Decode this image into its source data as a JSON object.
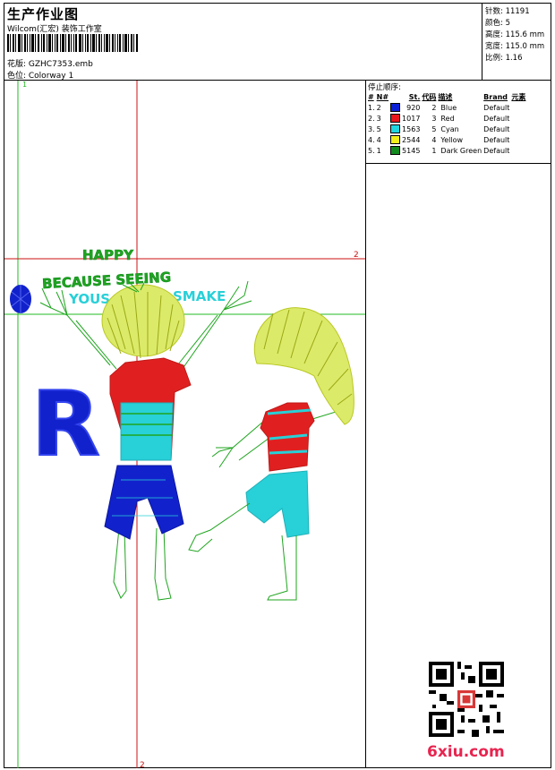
{
  "header": {
    "title": "生产作业图",
    "subtitle": "Wilcom(汇宏) 装饰工作室",
    "design_label": "花版: GZHC7353.emb",
    "colorway_label": "色位: Colorway 1"
  },
  "stats": [
    "针数: 11191",
    "颜色: 5",
    "高度: 115.6 mm",
    "宽度: 115.0 mm",
    "比例: 1.16"
  ],
  "stop_sequence": {
    "title": "停止顺序:",
    "headers": [
      "#",
      "N#",
      "St.",
      "代码",
      "描述",
      "Brand",
      "元素"
    ],
    "rows": [
      {
        "idx": "1.",
        "n": "2",
        "color": "#0a1fd6",
        "st": "920",
        "code": "2",
        "desc": "Blue",
        "brand": "Default"
      },
      {
        "idx": "2.",
        "n": "3",
        "color": "#e8161b",
        "st": "1017",
        "code": "3",
        "desc": "Red",
        "brand": "Default"
      },
      {
        "idx": "3.",
        "n": "5",
        "color": "#22d6e0",
        "st": "1563",
        "code": "5",
        "desc": "Cyan",
        "brand": "Default"
      },
      {
        "idx": "4.",
        "n": "4",
        "color": "#f2ef1a",
        "st": "2544",
        "code": "4",
        "desc": "Yellow",
        "brand": "Default"
      },
      {
        "idx": "5.",
        "n": "1",
        "color": "#128a1e",
        "st": "5145",
        "code": "1",
        "desc": "Dark Green",
        "brand": "Default"
      }
    ]
  },
  "canvas": {
    "marker_top": "1",
    "marker_right": "2",
    "marker_bottom": "2",
    "text_happy": "HAPPY",
    "text_because": "BECAUSE SEEING",
    "text_yous": "YOUS",
    "text_smake": "SMAKE",
    "letter": "R"
  },
  "watermark": "6xiu.com",
  "colors": {
    "guide_green": "#22bb22",
    "guide_red": "#cc1111",
    "thread_green": "#1fa51f",
    "thread_cyan": "#28d0d8",
    "thread_blue": "#1122cc",
    "thread_red": "#e02020",
    "thread_yellow": "#d8e030"
  }
}
